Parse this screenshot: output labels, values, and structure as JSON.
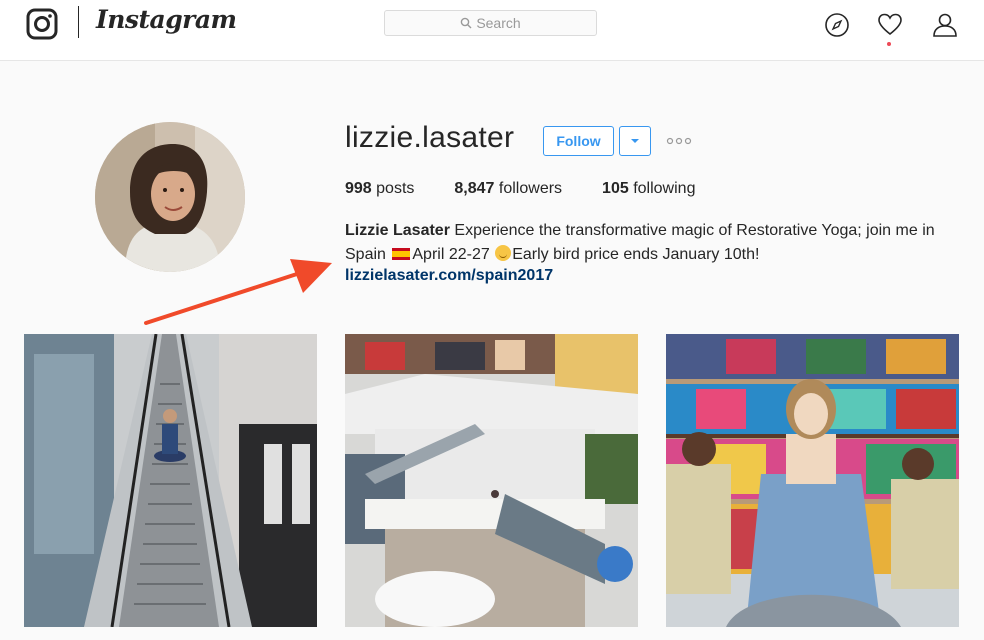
{
  "header": {
    "brand": "Instagram",
    "search_placeholder": "Search",
    "icons": [
      "camera-logo-icon",
      "compass-icon",
      "heart-icon",
      "person-icon"
    ],
    "notification_dot_color": "#ed4956"
  },
  "profile": {
    "username": "lizzie.lasater",
    "follow_label": "Follow",
    "stats": {
      "posts_count": "998",
      "posts_label": "posts",
      "followers_count": "8,847",
      "followers_label": "followers",
      "following_count": "105",
      "following_label": "following"
    },
    "bio": {
      "name": "Lizzie Lasater",
      "text_part1": "Experience the transformative magic of Restorative Yoga; join me in Spain",
      "text_part2": "April 22-27",
      "text_part3": "Early bird price ends January 10th!"
    },
    "link": "lizzielasater.com/spain2017"
  },
  "posts": [
    {
      "subject": "woman meditating on escalator"
    },
    {
      "subject": "woman meditating in shopping mall atrium"
    },
    {
      "subject": "woman meditating in fabric shop"
    }
  ],
  "colors": {
    "accent": "#3897f0",
    "link": "#003569",
    "annotation_arrow": "#f04a2a"
  }
}
